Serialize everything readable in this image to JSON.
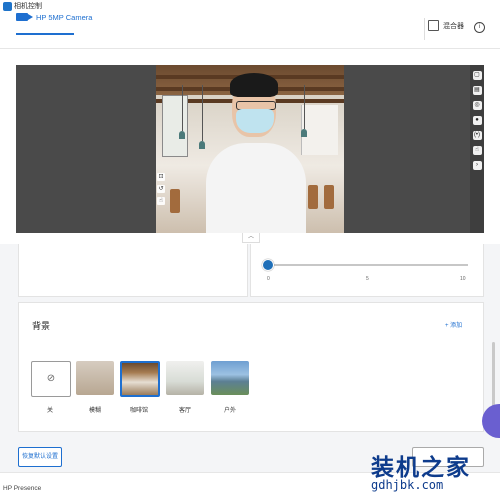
{
  "app": {
    "title": "相机控制"
  },
  "header": {
    "camera_tab": "HP 5MP Camera",
    "mix_label": "混合器",
    "info_symbol": "i"
  },
  "preview": {
    "left_tools": [
      "⊡",
      "↺",
      "☝"
    ],
    "right_tools": [
      "▢",
      "▤",
      "◎",
      "●",
      "(•)",
      "☝",
      "›"
    ],
    "collapse_symbol": "︿"
  },
  "slider": {
    "ticks": [
      "0",
      "5",
      "10"
    ],
    "value_fraction": 0.0
  },
  "background": {
    "title": "背景",
    "add_label": "+ 添加",
    "options": [
      {
        "id": "none",
        "label": "关",
        "symbol": "⊘",
        "selected": false
      },
      {
        "id": "blur",
        "label": "模糊",
        "selected": false
      },
      {
        "id": "cafe",
        "label": "咖啡馆",
        "selected": true
      },
      {
        "id": "living",
        "label": "客厅",
        "selected": false
      },
      {
        "id": "outdoor",
        "label": "户外",
        "selected": false
      }
    ]
  },
  "footer": {
    "reset_label": "恢复默认设置",
    "status_text": "HP Presence"
  },
  "watermark": {
    "brand": "装机之家",
    "url": "gdhjbk.com"
  },
  "colors": {
    "accent": "#1e6fd0",
    "preview_bg": "#4a4a4a",
    "watermark": "#0d3b8c"
  }
}
